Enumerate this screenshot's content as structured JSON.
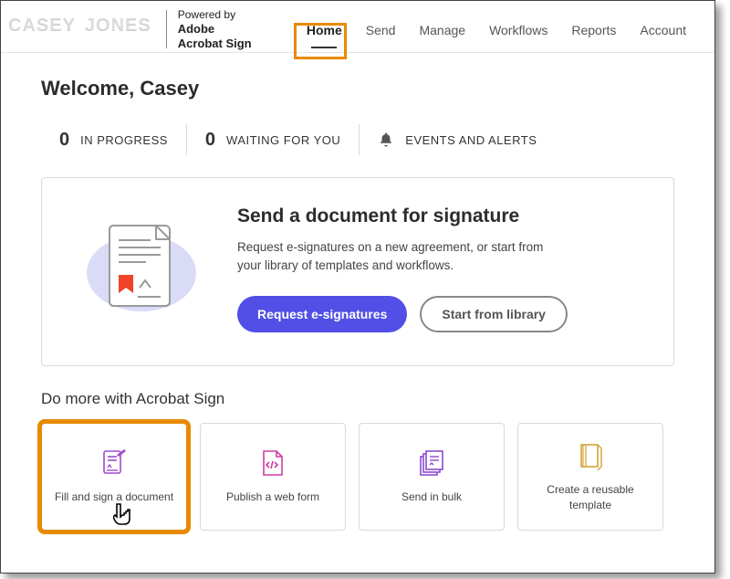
{
  "header": {
    "logo_first": "CASEY",
    "logo_last": "JONES",
    "powered_by": "Powered by",
    "brand_line1": "Adobe",
    "brand_line2": "Acrobat Sign",
    "nav": [
      "Home",
      "Send",
      "Manage",
      "Workflows",
      "Reports",
      "Account"
    ]
  },
  "welcome": "Welcome, Casey",
  "stats": {
    "in_progress_n": "0",
    "in_progress_l": "IN PROGRESS",
    "waiting_n": "0",
    "waiting_l": "WAITING FOR YOU",
    "events_l": "EVENTS AND ALERTS"
  },
  "card": {
    "title": "Send a document for signature",
    "body": "Request e-signatures on a new agreement, or start from your library of templates and workflows.",
    "primary": "Request e-signatures",
    "secondary": "Start from library"
  },
  "domore": {
    "title": "Do more with Acrobat Sign",
    "tiles": [
      "Fill and sign a document",
      "Publish a web form",
      "Send in bulk",
      "Create a reusable template"
    ]
  }
}
